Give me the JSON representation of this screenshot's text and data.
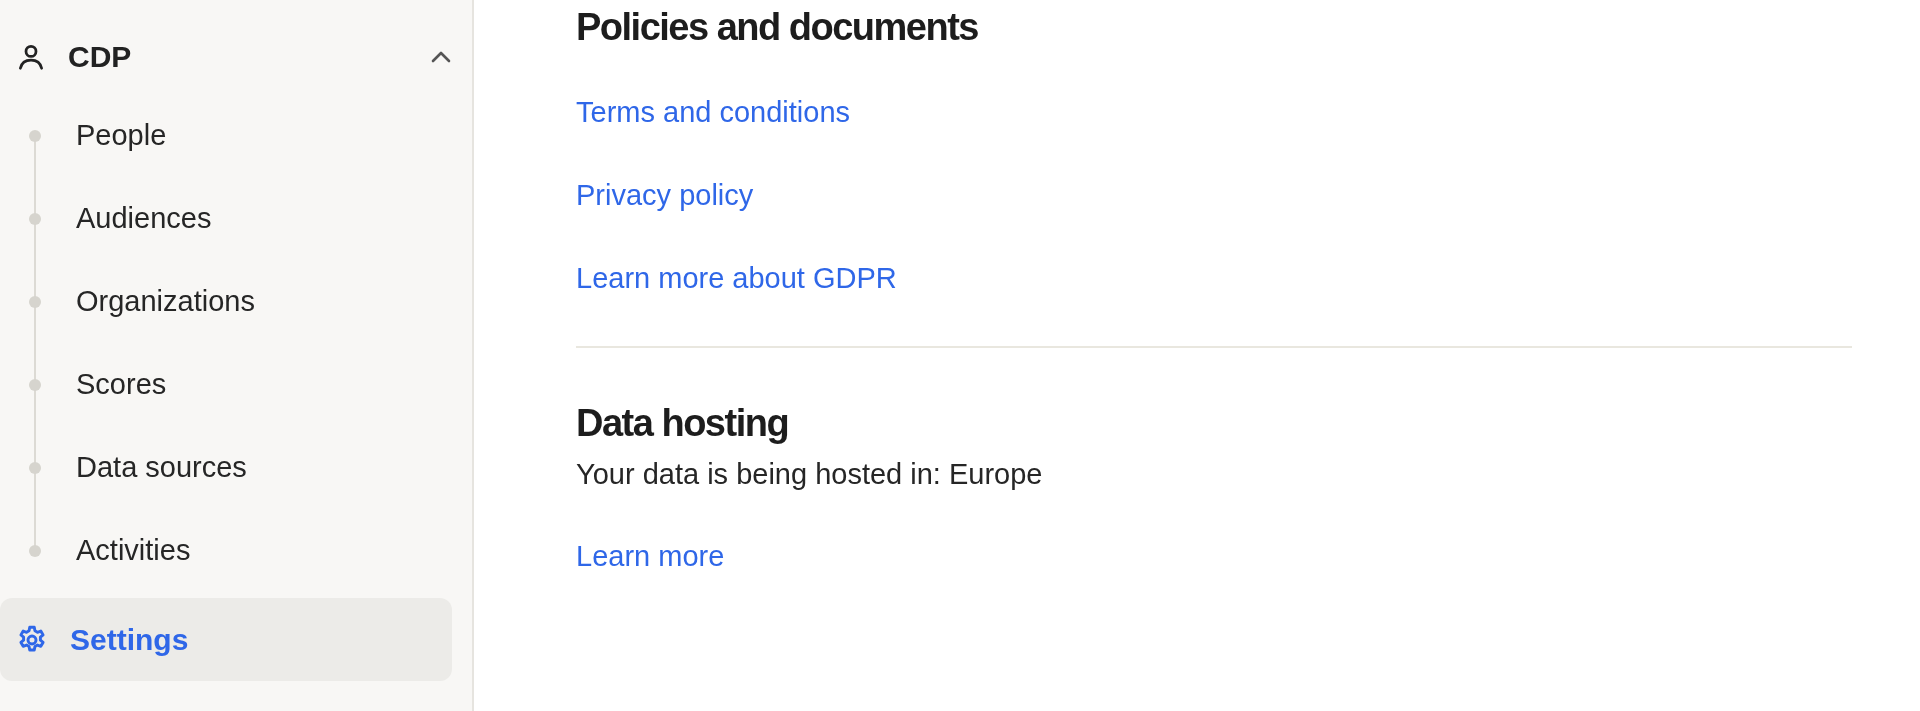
{
  "sidebar": {
    "group": {
      "label": "CDP",
      "expanded": true,
      "children": [
        {
          "label": "People",
          "selected": false
        },
        {
          "label": "Audiences",
          "selected": false
        },
        {
          "label": "Organizations",
          "selected": false
        },
        {
          "label": "Scores",
          "selected": false
        },
        {
          "label": "Data sources",
          "selected": false
        },
        {
          "label": "Activities",
          "selected": false
        }
      ]
    },
    "items": [
      {
        "label": "Settings",
        "selected": true
      }
    ]
  },
  "sections": [
    {
      "title": "Policies and documents",
      "links": [
        "Terms and conditions",
        "Privacy policy",
        "Learn more about GDPR"
      ]
    },
    {
      "title": "Data hosting",
      "text": "Your data is being hosted in: Europe",
      "links": [
        "Learn more"
      ]
    }
  ]
}
